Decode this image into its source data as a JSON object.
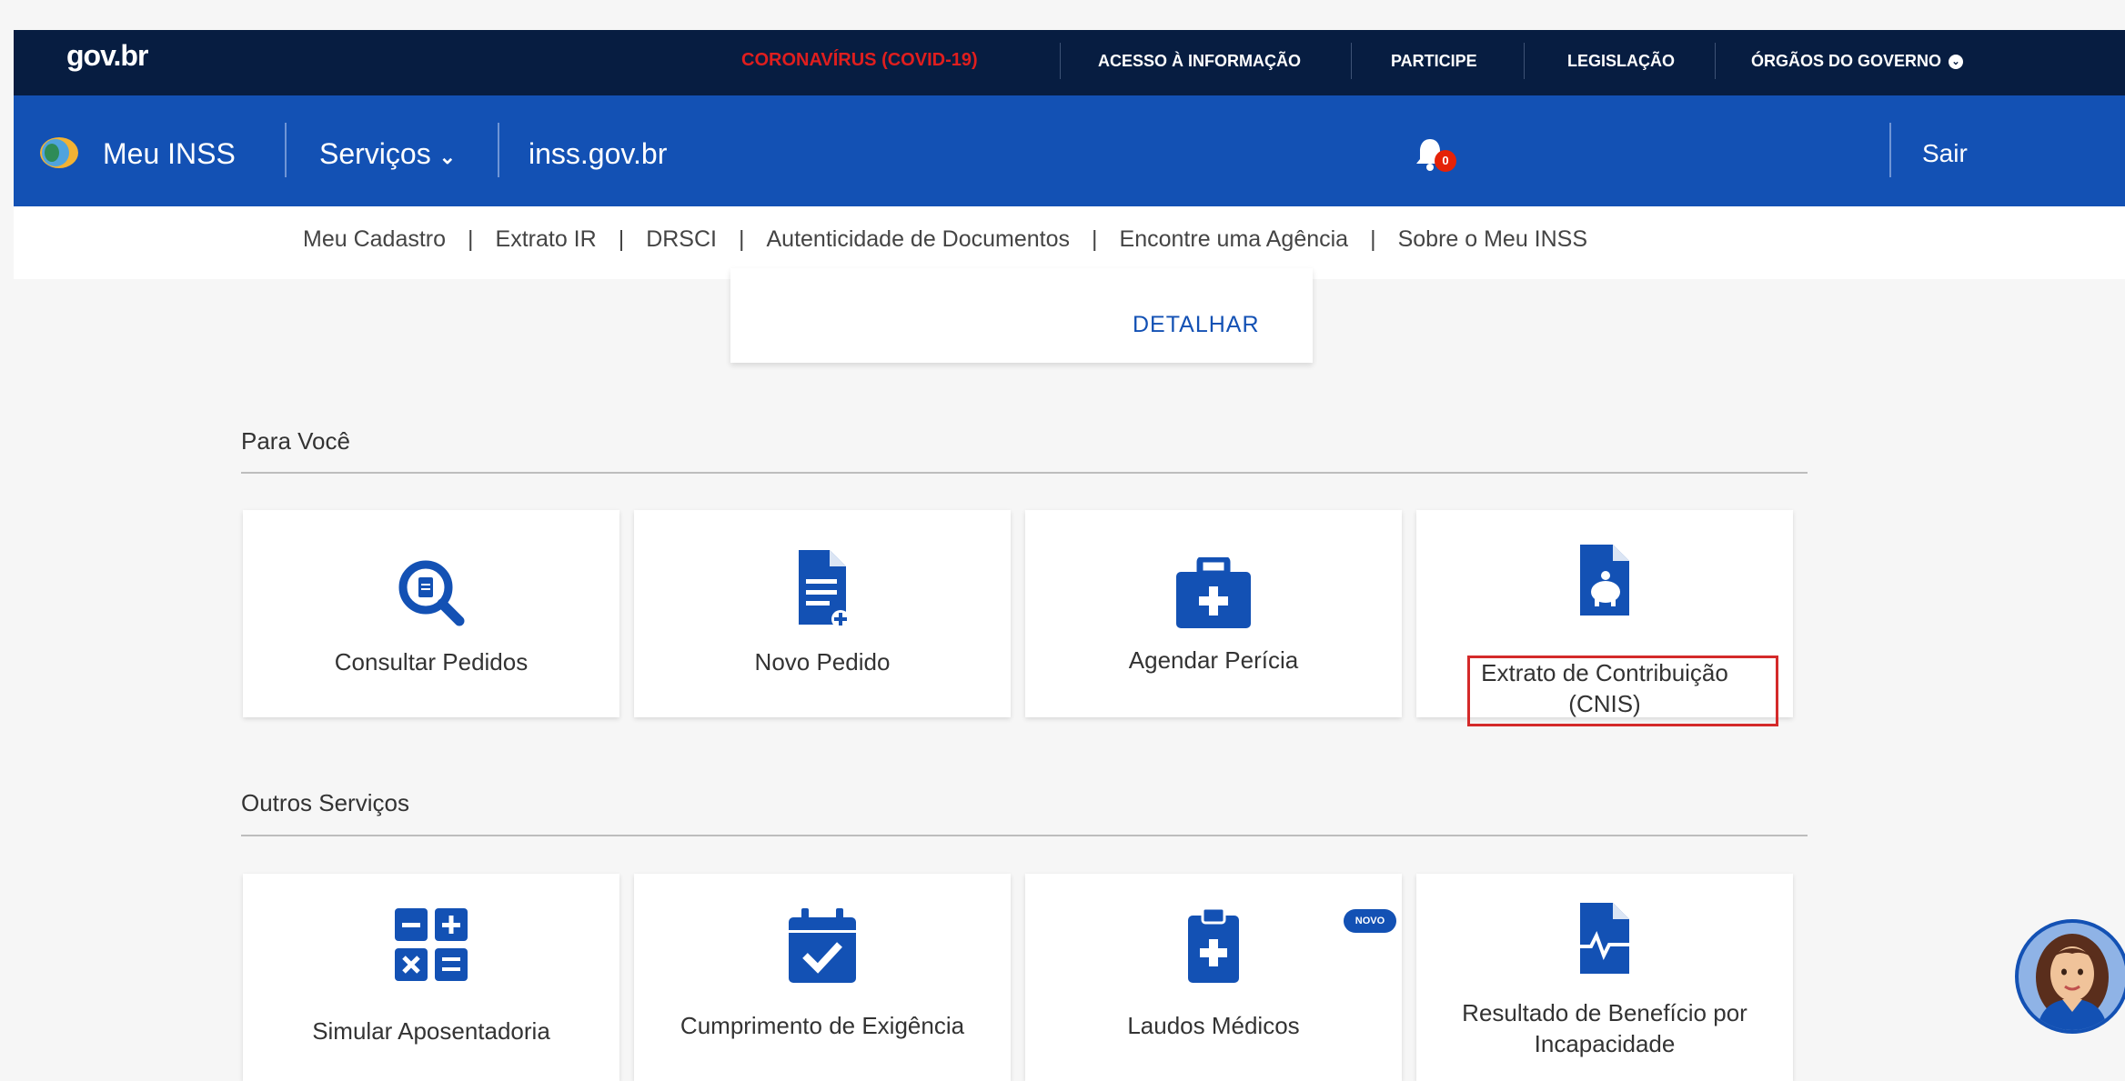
{
  "govbar": {
    "logo": "gov.br",
    "covid": "CORONAVÍRUS (COVID-19)",
    "links": [
      "ACESSO À INFORMAÇÃO",
      "PARTICIPE",
      "LEGISLAÇÃO",
      "ÓRGÃOS DO GOVERNO"
    ]
  },
  "header": {
    "app_name": "Meu INSS",
    "services_label": "Serviços",
    "site_link": "inss.gov.br",
    "notification_count": "0",
    "logout_label": "Sair"
  },
  "subnav": {
    "items": [
      "Meu Cadastro",
      "Extrato IR",
      "DRSCI",
      "Autenticidade de Documentos",
      "Encontre uma Agência",
      "Sobre o Meu INSS"
    ]
  },
  "detail_card": {
    "button_label": "DETALHAR"
  },
  "sections": [
    {
      "title": "Para Você",
      "cards": [
        {
          "label": "Consultar Pedidos",
          "icon": "search-document-icon"
        },
        {
          "label": "Novo Pedido",
          "icon": "new-document-icon"
        },
        {
          "label": "Agendar Perícia",
          "icon": "medical-kit-icon"
        },
        {
          "label_line1": "Extrato de Contribuição",
          "label_line2": "(CNIS)",
          "icon": "piggy-document-icon"
        }
      ]
    },
    {
      "title": "Outros Serviços",
      "cards": [
        {
          "label": "Simular Aposentadoria",
          "icon": "calculator-icon"
        },
        {
          "label": "Cumprimento de Exigência",
          "icon": "calendar-check-icon"
        },
        {
          "label": "Laudos Médicos",
          "icon": "medical-clipboard-icon",
          "badge": "NOVO"
        },
        {
          "label_line1": "Resultado de Benefício por",
          "label_line2": "Incapacidade",
          "icon": "document-pulse-icon"
        }
      ]
    }
  ],
  "colors": {
    "govbar_bg": "#071d41",
    "header_bg": "#1351b4",
    "accent": "#1351b4",
    "covid": "#e01e1e",
    "highlight_border": "#d42a2a"
  }
}
